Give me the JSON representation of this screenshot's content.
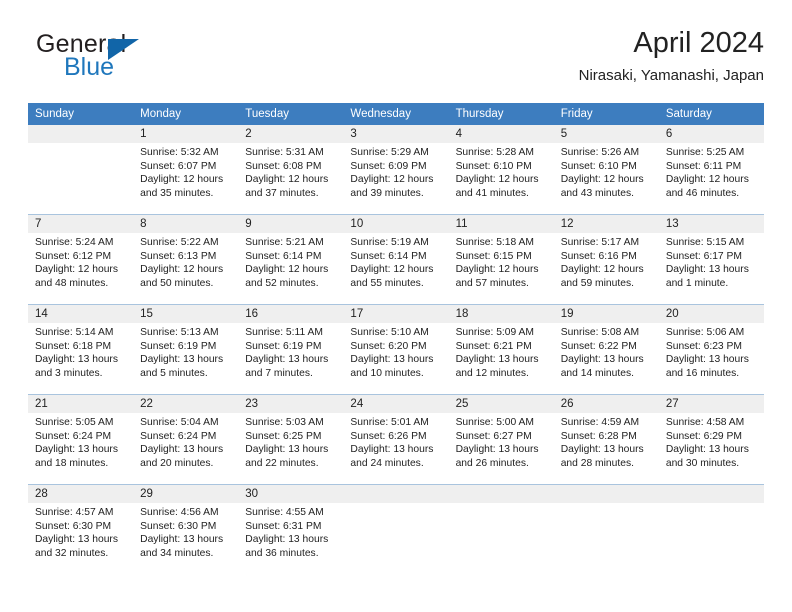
{
  "brand": {
    "word_general": "General",
    "word_blue": "Blue",
    "triangle_color": "#1165a8",
    "blue_color": "#1f77bc"
  },
  "header": {
    "title": "April 2024",
    "location": "Nirasaki, Yamanashi, Japan"
  },
  "theme": {
    "header_bar": "#3d7dbf",
    "daynum_bg": "#efefef",
    "grid_line": "#a9c4de",
    "text": "#222222"
  },
  "day_headers": [
    "Sunday",
    "Monday",
    "Tuesday",
    "Wednesday",
    "Thursday",
    "Friday",
    "Saturday"
  ],
  "weeks": [
    {
      "daynums": [
        "",
        "1",
        "2",
        "3",
        "4",
        "5",
        "6"
      ],
      "cells": [
        {
          "empty": true,
          "lines": []
        },
        {
          "empty": false,
          "lines": [
            "Sunrise: 5:32 AM",
            "Sunset: 6:07 PM",
            "Daylight: 12 hours",
            "and 35 minutes."
          ]
        },
        {
          "empty": false,
          "lines": [
            "Sunrise: 5:31 AM",
            "Sunset: 6:08 PM",
            "Daylight: 12 hours",
            "and 37 minutes."
          ]
        },
        {
          "empty": false,
          "lines": [
            "Sunrise: 5:29 AM",
            "Sunset: 6:09 PM",
            "Daylight: 12 hours",
            "and 39 minutes."
          ]
        },
        {
          "empty": false,
          "lines": [
            "Sunrise: 5:28 AM",
            "Sunset: 6:10 PM",
            "Daylight: 12 hours",
            "and 41 minutes."
          ]
        },
        {
          "empty": false,
          "lines": [
            "Sunrise: 5:26 AM",
            "Sunset: 6:10 PM",
            "Daylight: 12 hours",
            "and 43 minutes."
          ]
        },
        {
          "empty": false,
          "lines": [
            "Sunrise: 5:25 AM",
            "Sunset: 6:11 PM",
            "Daylight: 12 hours",
            "and 46 minutes."
          ]
        }
      ]
    },
    {
      "daynums": [
        "7",
        "8",
        "9",
        "10",
        "11",
        "12",
        "13"
      ],
      "cells": [
        {
          "empty": false,
          "lines": [
            "Sunrise: 5:24 AM",
            "Sunset: 6:12 PM",
            "Daylight: 12 hours",
            "and 48 minutes."
          ]
        },
        {
          "empty": false,
          "lines": [
            "Sunrise: 5:22 AM",
            "Sunset: 6:13 PM",
            "Daylight: 12 hours",
            "and 50 minutes."
          ]
        },
        {
          "empty": false,
          "lines": [
            "Sunrise: 5:21 AM",
            "Sunset: 6:14 PM",
            "Daylight: 12 hours",
            "and 52 minutes."
          ]
        },
        {
          "empty": false,
          "lines": [
            "Sunrise: 5:19 AM",
            "Sunset: 6:14 PM",
            "Daylight: 12 hours",
            "and 55 minutes."
          ]
        },
        {
          "empty": false,
          "lines": [
            "Sunrise: 5:18 AM",
            "Sunset: 6:15 PM",
            "Daylight: 12 hours",
            "and 57 minutes."
          ]
        },
        {
          "empty": false,
          "lines": [
            "Sunrise: 5:17 AM",
            "Sunset: 6:16 PM",
            "Daylight: 12 hours",
            "and 59 minutes."
          ]
        },
        {
          "empty": false,
          "lines": [
            "Sunrise: 5:15 AM",
            "Sunset: 6:17 PM",
            "Daylight: 13 hours",
            "and 1 minute."
          ]
        }
      ]
    },
    {
      "daynums": [
        "14",
        "15",
        "16",
        "17",
        "18",
        "19",
        "20"
      ],
      "cells": [
        {
          "empty": false,
          "lines": [
            "Sunrise: 5:14 AM",
            "Sunset: 6:18 PM",
            "Daylight: 13 hours",
            "and 3 minutes."
          ]
        },
        {
          "empty": false,
          "lines": [
            "Sunrise: 5:13 AM",
            "Sunset: 6:19 PM",
            "Daylight: 13 hours",
            "and 5 minutes."
          ]
        },
        {
          "empty": false,
          "lines": [
            "Sunrise: 5:11 AM",
            "Sunset: 6:19 PM",
            "Daylight: 13 hours",
            "and 7 minutes."
          ]
        },
        {
          "empty": false,
          "lines": [
            "Sunrise: 5:10 AM",
            "Sunset: 6:20 PM",
            "Daylight: 13 hours",
            "and 10 minutes."
          ]
        },
        {
          "empty": false,
          "lines": [
            "Sunrise: 5:09 AM",
            "Sunset: 6:21 PM",
            "Daylight: 13 hours",
            "and 12 minutes."
          ]
        },
        {
          "empty": false,
          "lines": [
            "Sunrise: 5:08 AM",
            "Sunset: 6:22 PM",
            "Daylight: 13 hours",
            "and 14 minutes."
          ]
        },
        {
          "empty": false,
          "lines": [
            "Sunrise: 5:06 AM",
            "Sunset: 6:23 PM",
            "Daylight: 13 hours",
            "and 16 minutes."
          ]
        }
      ]
    },
    {
      "daynums": [
        "21",
        "22",
        "23",
        "24",
        "25",
        "26",
        "27"
      ],
      "cells": [
        {
          "empty": false,
          "lines": [
            "Sunrise: 5:05 AM",
            "Sunset: 6:24 PM",
            "Daylight: 13 hours",
            "and 18 minutes."
          ]
        },
        {
          "empty": false,
          "lines": [
            "Sunrise: 5:04 AM",
            "Sunset: 6:24 PM",
            "Daylight: 13 hours",
            "and 20 minutes."
          ]
        },
        {
          "empty": false,
          "lines": [
            "Sunrise: 5:03 AM",
            "Sunset: 6:25 PM",
            "Daylight: 13 hours",
            "and 22 minutes."
          ]
        },
        {
          "empty": false,
          "lines": [
            "Sunrise: 5:01 AM",
            "Sunset: 6:26 PM",
            "Daylight: 13 hours",
            "and 24 minutes."
          ]
        },
        {
          "empty": false,
          "lines": [
            "Sunrise: 5:00 AM",
            "Sunset: 6:27 PM",
            "Daylight: 13 hours",
            "and 26 minutes."
          ]
        },
        {
          "empty": false,
          "lines": [
            "Sunrise: 4:59 AM",
            "Sunset: 6:28 PM",
            "Daylight: 13 hours",
            "and 28 minutes."
          ]
        },
        {
          "empty": false,
          "lines": [
            "Sunrise: 4:58 AM",
            "Sunset: 6:29 PM",
            "Daylight: 13 hours",
            "and 30 minutes."
          ]
        }
      ]
    },
    {
      "daynums": [
        "28",
        "29",
        "30",
        "",
        "",
        "",
        ""
      ],
      "cells": [
        {
          "empty": false,
          "lines": [
            "Sunrise: 4:57 AM",
            "Sunset: 6:30 PM",
            "Daylight: 13 hours",
            "and 32 minutes."
          ]
        },
        {
          "empty": false,
          "lines": [
            "Sunrise: 4:56 AM",
            "Sunset: 6:30 PM",
            "Daylight: 13 hours",
            "and 34 minutes."
          ]
        },
        {
          "empty": false,
          "lines": [
            "Sunrise: 4:55 AM",
            "Sunset: 6:31 PM",
            "Daylight: 13 hours",
            "and 36 minutes."
          ]
        },
        {
          "empty": true,
          "lines": []
        },
        {
          "empty": true,
          "lines": []
        },
        {
          "empty": true,
          "lines": []
        },
        {
          "empty": true,
          "lines": []
        }
      ]
    }
  ]
}
